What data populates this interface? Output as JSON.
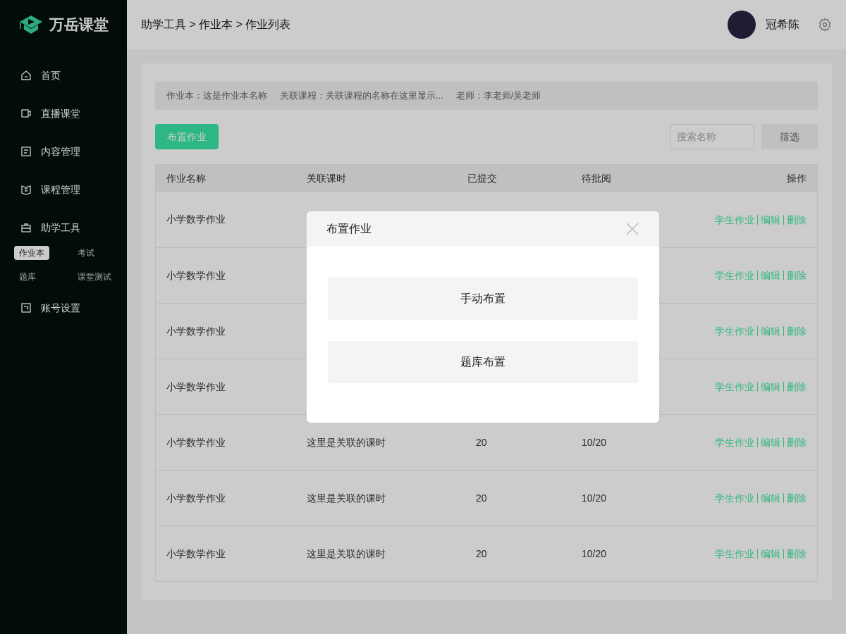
{
  "brand": {
    "name": "万岳课堂"
  },
  "sidebar": {
    "items": [
      {
        "label": "首页",
        "selected": false
      },
      {
        "label": "直播课堂",
        "selected": false
      },
      {
        "label": "内容管理",
        "selected": false
      },
      {
        "label": "课程管理",
        "selected": false
      },
      {
        "label": "助学工具",
        "selected": false,
        "children": [
          {
            "label": "作业本",
            "selected": true
          },
          {
            "label": "考试",
            "selected": false
          },
          {
            "label": "题库",
            "selected": false
          },
          {
            "label": "课堂测试",
            "selected": false
          }
        ]
      },
      {
        "label": "账号设置",
        "selected": false
      }
    ]
  },
  "header": {
    "breadcrumb": "助学工具 > 作业本 > 作业列表",
    "user": "冠希陈"
  },
  "info_bar": [
    "作业本：这是作业本名称",
    "关联课程：关联课程的名称在这里显示...",
    "老师：李老师/吴老师"
  ],
  "toolbar": {
    "primary_button": "布置作业",
    "search": {
      "placeholder": "搜索名称"
    },
    "filter_button": "筛选"
  },
  "table": {
    "columns": [
      "作业名称",
      "关联课时",
      "已提交",
      "待批阅",
      "操作"
    ],
    "rows": [
      {
        "name": "小学数学作业",
        "actions": [
          "学生作业",
          "编辑",
          "删除"
        ]
      },
      {
        "name": "小学数学作业",
        "actions": [
          "学生作业",
          "编辑",
          "删除"
        ]
      },
      {
        "name": "小学数学作业",
        "actions": [
          "学生作业",
          "编辑",
          "删除"
        ]
      },
      {
        "name": "小学数学作业",
        "actions": [
          "学生作业",
          "编辑",
          "删除"
        ]
      },
      {
        "name": "小学数学作业",
        "lesson": "这里是关联的课时",
        "submitted": "20",
        "pending": "10/20",
        "actions": [
          "学生作业",
          "编辑",
          "删除"
        ]
      },
      {
        "name": "小学数学作业",
        "lesson": "这里是关联的课时",
        "submitted": "20",
        "pending": "10/20",
        "actions": [
          "学生作业",
          "编辑",
          "删除"
        ]
      },
      {
        "name": "小学数学作业",
        "lesson": "这里是关联的课时",
        "submitted": "20",
        "pending": "10/20",
        "actions": [
          "学生作业",
          "编辑",
          "删除"
        ]
      }
    ]
  },
  "dialog": {
    "title": "布置作业",
    "options": [
      "手动布置",
      "题库布置"
    ]
  }
}
